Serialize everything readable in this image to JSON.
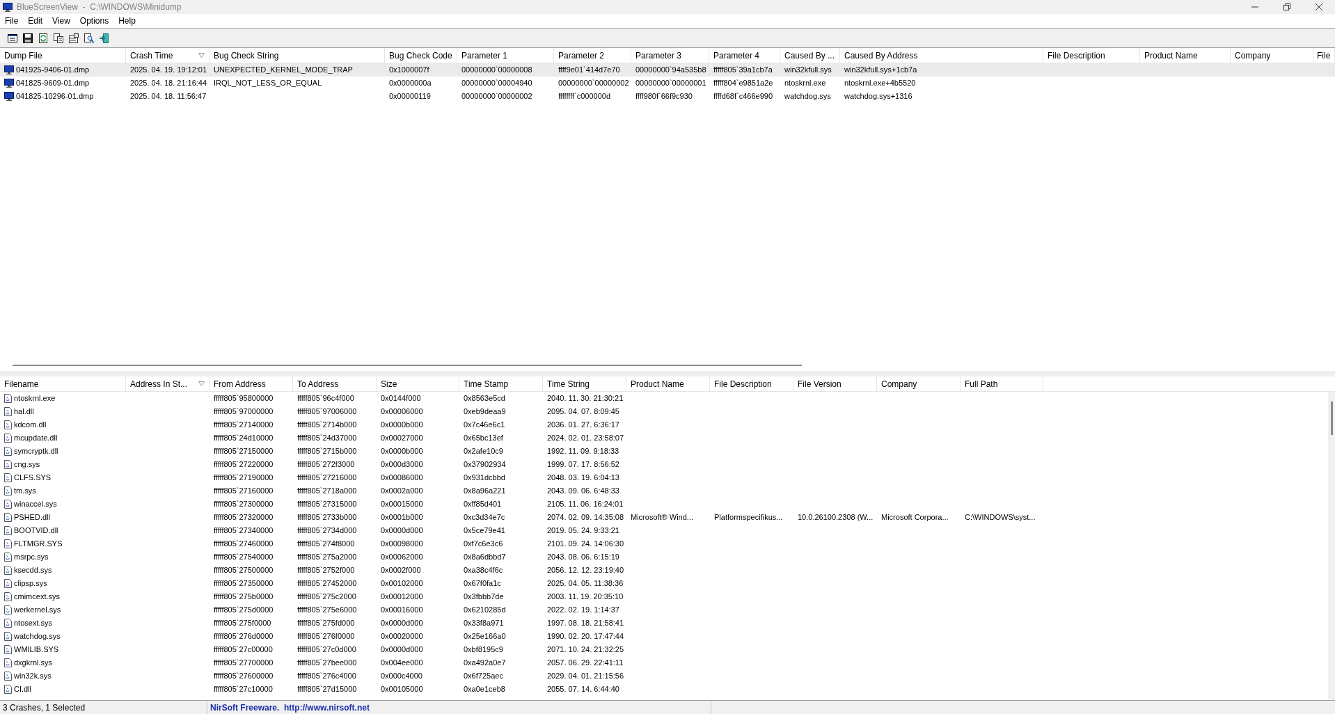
{
  "window": {
    "title": "BlueScreenView  -  C:\\WINDOWS\\Minidump"
  },
  "menu": [
    "File",
    "Edit",
    "View",
    "Options",
    "Help"
  ],
  "crash_table": {
    "columns": [
      {
        "label": "Dump File",
        "sorted": false
      },
      {
        "label": "Crash Time",
        "sorted": true
      },
      {
        "label": "Bug Check String",
        "sorted": false
      },
      {
        "label": "Bug Check Code",
        "sorted": false
      },
      {
        "label": "Parameter 1",
        "sorted": false
      },
      {
        "label": "Parameter 2",
        "sorted": false
      },
      {
        "label": "Parameter 3",
        "sorted": false
      },
      {
        "label": "Parameter 4",
        "sorted": false
      },
      {
        "label": "Caused By ...",
        "sorted": false
      },
      {
        "label": "Caused By Address",
        "sorted": false
      },
      {
        "label": "File Description",
        "sorted": false
      },
      {
        "label": "Product Name",
        "sorted": false
      },
      {
        "label": "Company",
        "sorted": false
      },
      {
        "label": "File",
        "sorted": false
      }
    ],
    "rows": [
      {
        "selected": true,
        "cells": [
          "041925-9406-01.dmp",
          "2025. 04. 19. 19:12:01",
          "UNEXPECTED_KERNEL_MODE_TRAP",
          "0x1000007f",
          "00000000`00000008",
          "ffff9e01`414d7e70",
          "00000000`94a535b8",
          "fffff805`39a1cb7a",
          "win32kfull.sys",
          "win32kfull.sys+1cb7a"
        ]
      },
      {
        "selected": false,
        "cells": [
          "041825-9609-01.dmp",
          "2025. 04. 18. 21:16:44",
          "IRQL_NOT_LESS_OR_EQUAL",
          "0x0000000a",
          "00000000`00004940",
          "00000000`00000002",
          "00000000`00000001",
          "fffff804`e9851a2e",
          "ntoskrnl.exe",
          "ntoskrnl.exe+4b5520"
        ]
      },
      {
        "selected": false,
        "cells": [
          "041825-10296-01.dmp",
          "2025. 04. 18. 11:56:47",
          null,
          "0x00000119",
          "00000000`00000002",
          "ffffffff`c000000d",
          "ffff980f`66f9c930",
          "ffffd68f`c466e990",
          "watchdog.sys",
          "watchdog.sys+1316"
        ]
      }
    ]
  },
  "driver_table": {
    "columns": [
      {
        "label": "Filename",
        "sorted": false
      },
      {
        "label": "Address In St...",
        "sorted": true
      },
      {
        "label": "From Address",
        "sorted": false
      },
      {
        "label": "To Address",
        "sorted": false
      },
      {
        "label": "Size",
        "sorted": false
      },
      {
        "label": "Time Stamp",
        "sorted": false
      },
      {
        "label": "Time String",
        "sorted": false
      },
      {
        "label": "Product Name",
        "sorted": false
      },
      {
        "label": "File Description",
        "sorted": false
      },
      {
        "label": "File Version",
        "sorted": false
      },
      {
        "label": "Company",
        "sorted": false
      },
      {
        "label": "Full Path",
        "sorted": false
      }
    ],
    "rows": [
      {
        "cells": [
          "ntoskrnl.exe",
          null,
          "fffff805`95800000",
          "fffff805`96c4f000",
          "0x0144f000",
          "0x8563e5cd",
          "2040. 11. 30. 21:30:21"
        ]
      },
      {
        "cells": [
          "hal.dll",
          null,
          "fffff805`97000000",
          "fffff805`97006000",
          "0x00006000",
          "0xeb9deaa9",
          "2095. 04. 07. 8:09:45"
        ]
      },
      {
        "cells": [
          "kdcom.dll",
          null,
          "fffff805`27140000",
          "fffff805`2714b000",
          "0x0000b000",
          "0x7c46e6c1",
          "2036. 01. 27. 6:36:17"
        ]
      },
      {
        "cells": [
          "mcupdate.dll",
          null,
          "fffff805`24d10000",
          "fffff805`24d37000",
          "0x00027000",
          "0x65bc13ef",
          "2024. 02. 01. 23:58:07"
        ]
      },
      {
        "cells": [
          "symcryptk.dll",
          null,
          "fffff805`27150000",
          "fffff805`2715b000",
          "0x0000b000",
          "0x2afe10c9",
          "1992. 11. 09. 9:18:33"
        ]
      },
      {
        "cells": [
          "cng.sys",
          null,
          "fffff805`27220000",
          "fffff805`272f3000",
          "0x000d3000",
          "0x37902934",
          "1999. 07. 17. 8:56:52"
        ]
      },
      {
        "cells": [
          "CLFS.SYS",
          null,
          "fffff805`27190000",
          "fffff805`27216000",
          "0x00086000",
          "0x931dcbbd",
          "2048. 03. 19. 6:04:13"
        ]
      },
      {
        "cells": [
          "tm.sys",
          null,
          "fffff805`27160000",
          "fffff805`2718a000",
          "0x0002a000",
          "0x8a96a221",
          "2043. 09. 06. 6:48:33"
        ]
      },
      {
        "cells": [
          "winaccel.sys",
          null,
          "fffff805`27300000",
          "fffff805`27315000",
          "0x00015000",
          "0xff85d401",
          "2105. 11. 06. 16:24:01"
        ]
      },
      {
        "cells": [
          "PSHED.dll",
          null,
          "fffff805`27320000",
          "fffff805`2733b000",
          "0x0001b000",
          "0xc3d34e7c",
          "2074. 02. 09. 14:35:08",
          "Microsoft® Wind...",
          "Platformspecifikus...",
          "10.0.26100.2308 (W...",
          "Microsoft Corpora...",
          "C:\\WINDOWS\\syst..."
        ]
      },
      {
        "cells": [
          "BOOTVID.dll",
          null,
          "fffff805`27340000",
          "fffff805`2734d000",
          "0x0000d000",
          "0x5ce79e41",
          "2019. 05. 24. 9:33:21"
        ]
      },
      {
        "cells": [
          "FLTMGR.SYS",
          null,
          "fffff805`27460000",
          "fffff805`274f8000",
          "0x00098000",
          "0xf7c6e3c6",
          "2101. 09. 24. 14:06:30"
        ]
      },
      {
        "cells": [
          "msrpc.sys",
          null,
          "fffff805`27540000",
          "fffff805`275a2000",
          "0x00062000",
          "0x8a6dbbd7",
          "2043. 08. 06. 6:15:19"
        ]
      },
      {
        "cells": [
          "ksecdd.sys",
          null,
          "fffff805`27500000",
          "fffff805`2752f000",
          "0x0002f000",
          "0xa38c4f6c",
          "2056. 12. 12. 23:19:40"
        ]
      },
      {
        "cells": [
          "clipsp.sys",
          null,
          "fffff805`27350000",
          "fffff805`27452000",
          "0x00102000",
          "0x67f0fa1c",
          "2025. 04. 05. 11:38:36"
        ]
      },
      {
        "cells": [
          "cmimcext.sys",
          null,
          "fffff805`275b0000",
          "fffff805`275c2000",
          "0x00012000",
          "0x3fbbb7de",
          "2003. 11. 19. 20:35:10"
        ]
      },
      {
        "cells": [
          "werkernel.sys",
          null,
          "fffff805`275d0000",
          "fffff805`275e6000",
          "0x00016000",
          "0x6210285d",
          "2022. 02. 19. 1:14:37"
        ]
      },
      {
        "cells": [
          "ntosext.sys",
          null,
          "fffff805`275f0000",
          "fffff805`275fd000",
          "0x0000d000",
          "0x33f8a971",
          "1997. 08. 18. 21:58:41"
        ]
      },
      {
        "cells": [
          "watchdog.sys",
          null,
          "fffff805`276d0000",
          "fffff805`276f0000",
          "0x00020000",
          "0x25e166a0",
          "1990. 02. 20. 17:47:44"
        ]
      },
      {
        "cells": [
          "WMILIB.SYS",
          null,
          "fffff805`27c00000",
          "fffff805`27c0d000",
          "0x0000d000",
          "0xbf8195c9",
          "2071. 10. 24. 21:32:25"
        ]
      },
      {
        "cells": [
          "dxgkrnl.sys",
          null,
          "fffff805`27700000",
          "fffff805`27bee000",
          "0x004ee000",
          "0xa492a0e7",
          "2057. 06. 29. 22:41:11"
        ]
      },
      {
        "cells": [
          "win32k.sys",
          null,
          "fffff805`27600000",
          "fffff805`276c4000",
          "0x000c4000",
          "0x6f725aec",
          "2029. 04. 01. 21:15:56"
        ]
      },
      {
        "cells": [
          "CI.dll",
          null,
          "fffff805`27c10000",
          "fffff805`27d15000",
          "0x00105000",
          "0xa0e1ceb8",
          "2055. 07. 14. 6:44:40"
        ]
      }
    ]
  },
  "status_bar": {
    "summary": "3 Crashes, 1 Selected",
    "credit": "NirSoft Freeware.  http://www.nirsoft.net"
  }
}
